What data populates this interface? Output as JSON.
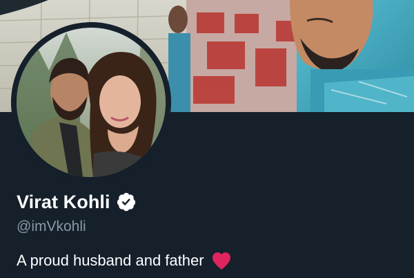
{
  "profile": {
    "display_name": "Virat Kohli",
    "handle": "@imVkohli",
    "bio": "A proud husband and father",
    "verified": true
  },
  "colors": {
    "background": "#15202b",
    "name_text": "#ffffff",
    "handle_text": "#8899a6",
    "heart": "#e0245e"
  },
  "icons": {
    "verified": "verified-badge-icon",
    "bio_emoji": "red-heart-icon"
  }
}
